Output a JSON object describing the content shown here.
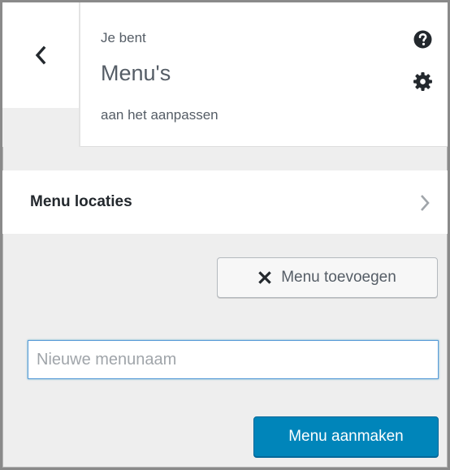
{
  "header": {
    "pre_title": "Je bent",
    "title": "Menu's",
    "post_title": "aan het aanpassen",
    "back_icon": "chevron-left-icon",
    "help_icon": "question-circle-icon",
    "settings_icon": "gear-icon"
  },
  "section": {
    "label": "Menu locaties",
    "chevron_icon": "chevron-right-icon"
  },
  "add_menu_button": {
    "label": "Menu toevoegen",
    "icon": "close-x-icon"
  },
  "new_menu_input": {
    "value": "",
    "placeholder": "Nieuwe menunaam"
  },
  "create_button": {
    "label": "Menu aanmaken"
  },
  "colors": {
    "accent": "#0085ba",
    "text": "#555d66",
    "heading": "#23282d",
    "panel_background": "#eeeeee"
  }
}
